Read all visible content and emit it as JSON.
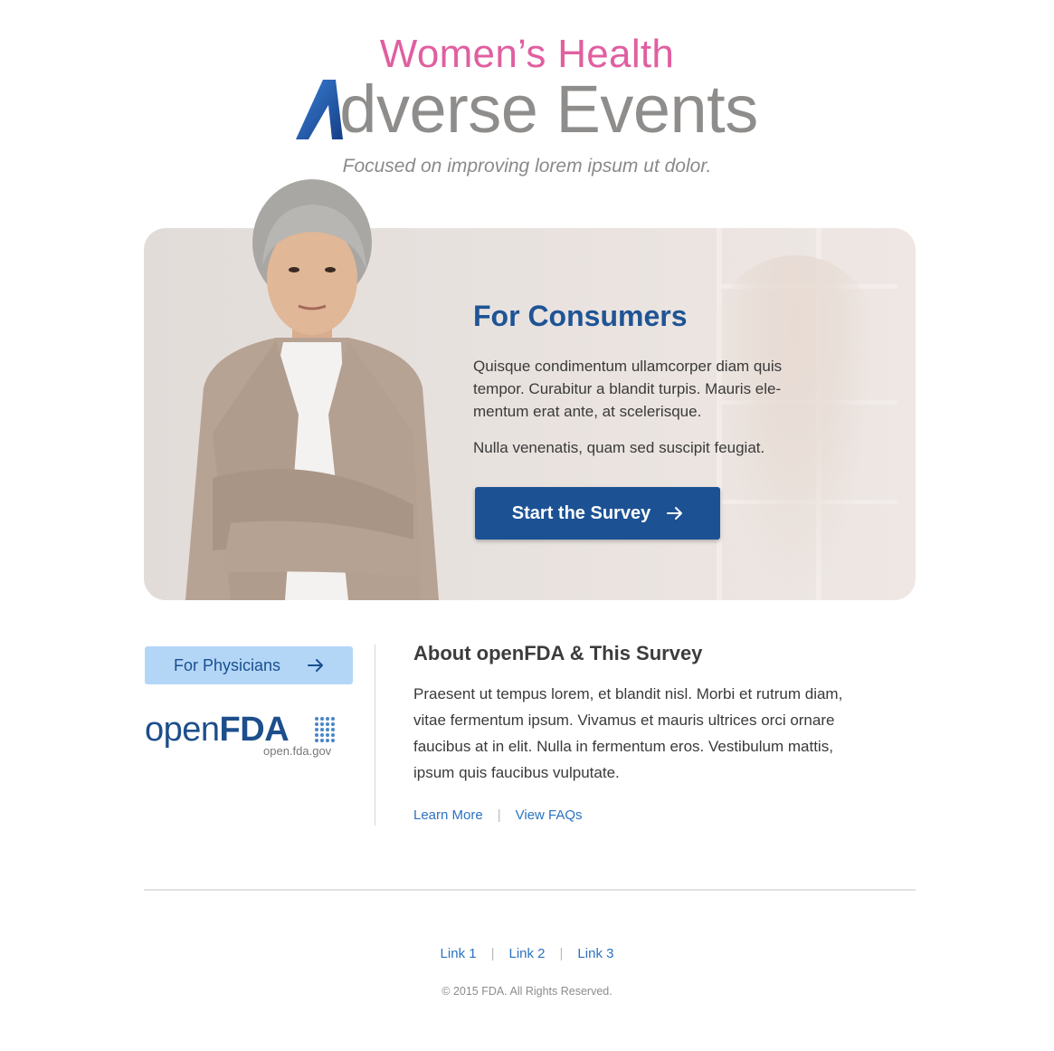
{
  "header": {
    "subtitle": "Women’s Health",
    "title_rest": "dverse Events",
    "tagline": "Focused on improving lorem ipsum ut dolor."
  },
  "hero": {
    "heading": "For Consumers",
    "paragraph_1": "Quisque condimentum ullamcorper diam quis tempor. Curabitur a blandit turpis. Mauris ele-mentum erat ante, at scelerisque.",
    "paragraph_2": "Nulla venenatis, quam sed suscipit feugiat.",
    "cta_label": "Start the Survey",
    "cta_icon": "arrow-right-icon"
  },
  "sidebar": {
    "physicians_label": "For Physicians",
    "physicians_icon": "arrow-right-icon",
    "logo_text_open": "open",
    "logo_text_fda": "FDA",
    "logo_url": "open.fda.gov"
  },
  "about": {
    "title": "About openFDA & This Survey",
    "body": "Praesent ut tempus lorem, et blandit nisl. Morbi et rutrum diam, vitae fermentum ipsum. Vivamus et mauris ultrices orci ornare faucibus at in elit. Nulla in fermentum eros. Vestibulum mattis, ipsum quis faucibus vulputate.",
    "links": [
      "Learn More",
      "View FAQs"
    ],
    "separator": "|"
  },
  "footer": {
    "links": [
      "Link 1",
      "Link 2",
      "Link 3"
    ],
    "separator": "|",
    "copyright": "© 2015 FDA. All Rights Reserved."
  },
  "colors": {
    "pink": "#e05fa0",
    "title_gray": "#8f8d8b",
    "brand_blue": "#1c5294",
    "light_blue_button": "#b3d6f7",
    "link_blue": "#2b73c0"
  }
}
